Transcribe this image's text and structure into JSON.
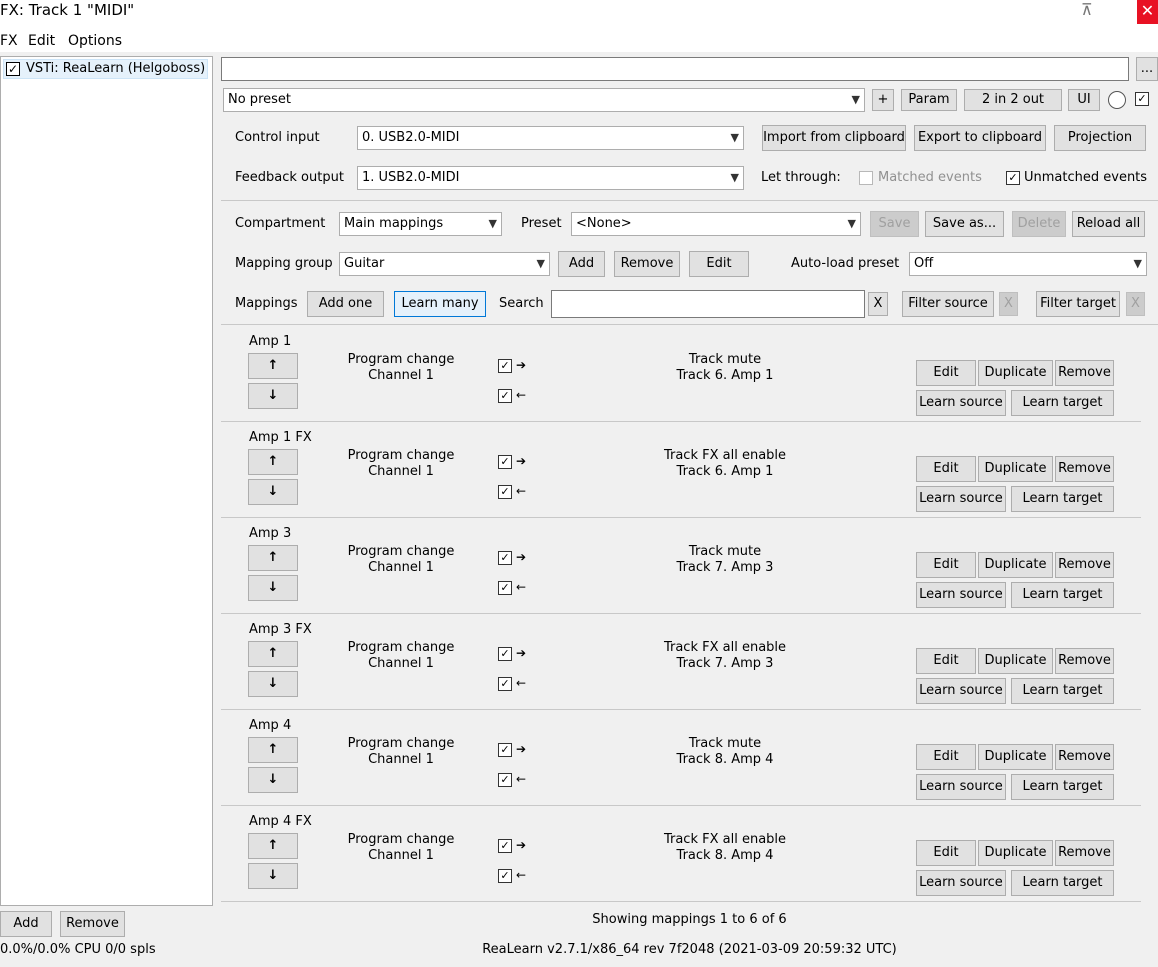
{
  "window": {
    "title": "FX: Track 1 \"MIDI\"",
    "close": "✕",
    "pin": "⊼"
  },
  "menu": [
    "FX",
    "Edit",
    "Options"
  ],
  "fx_list": {
    "item": "VSTi: ReaLearn (Helgoboss)",
    "checked": "✓"
  },
  "bottom_left": {
    "add": "Add",
    "remove": "Remove",
    "cpu": "0.0%/0.0% CPU 0/0 spls"
  },
  "top": {
    "more_button": "...",
    "preset": "No preset",
    "plus": "+",
    "param": "Param",
    "io": "2 in 2 out",
    "ui": "UI",
    "enabled_check": "✓"
  },
  "control": {
    "control_input_label": "Control input",
    "control_input_value": "0. USB2.0-MIDI",
    "feedback_output_label": "Feedback output",
    "feedback_output_value": "1. USB2.0-MIDI",
    "import": "Import from clipboard",
    "export": "Export to clipboard",
    "projection": "Projection",
    "let_through": "Let through:",
    "matched": "Matched events",
    "unmatched": "Unmatched events",
    "unmatched_check": "✓"
  },
  "compartment": {
    "label": "Compartment",
    "value": "Main mappings",
    "preset_label": "Preset",
    "preset_value": "<None>",
    "save": "Save",
    "save_as": "Save as...",
    "delete": "Delete",
    "reload": "Reload all"
  },
  "group": {
    "label": "Mapping group",
    "value": "Guitar",
    "add": "Add",
    "remove": "Remove",
    "edit": "Edit",
    "autoload_label": "Auto-load preset",
    "autoload_value": "Off"
  },
  "mappings_bar": {
    "label": "Mappings",
    "add_one": "Add one",
    "learn_many": "Learn many",
    "search_label": "Search",
    "clear": "X",
    "filter_source": "Filter source",
    "filter_target": "Filter target"
  },
  "row_labels": {
    "up": "↑",
    "down": "↓",
    "check": "✓",
    "arrow_right": "➔",
    "arrow_left": "←",
    "edit": "Edit",
    "duplicate": "Duplicate",
    "remove": "Remove",
    "learn_source": "Learn source",
    "learn_target": "Learn target"
  },
  "mappings": [
    {
      "name": "Amp 1",
      "source_line1": "Program change",
      "source_line2": "Channel 1",
      "target_line1": "Track mute",
      "target_line2": "Track 6. Amp 1"
    },
    {
      "name": "Amp 1 FX",
      "source_line1": "Program change",
      "source_line2": "Channel 1",
      "target_line1": "Track FX all enable",
      "target_line2": "Track 6. Amp 1"
    },
    {
      "name": "Amp 3",
      "source_line1": "Program change",
      "source_line2": "Channel 1",
      "target_line1": "Track mute",
      "target_line2": "Track 7. Amp 3"
    },
    {
      "name": "Amp 3 FX",
      "source_line1": "Program change",
      "source_line2": "Channel 1",
      "target_line1": "Track FX all enable",
      "target_line2": "Track 7. Amp 3"
    },
    {
      "name": "Amp 4",
      "source_line1": "Program change",
      "source_line2": "Channel 1",
      "target_line1": "Track mute",
      "target_line2": "Track 8. Amp 4"
    },
    {
      "name": "Amp 4 FX",
      "source_line1": "Program change",
      "source_line2": "Channel 1",
      "target_line1": "Track FX all enable",
      "target_line2": "Track 8. Amp 4"
    }
  ],
  "status": {
    "showing": "Showing mappings 1 to 6 of 6",
    "version": "ReaLearn v2.7.1/x86_64 rev 7f2048 (2021-03-09 20:59:32 UTC)"
  }
}
